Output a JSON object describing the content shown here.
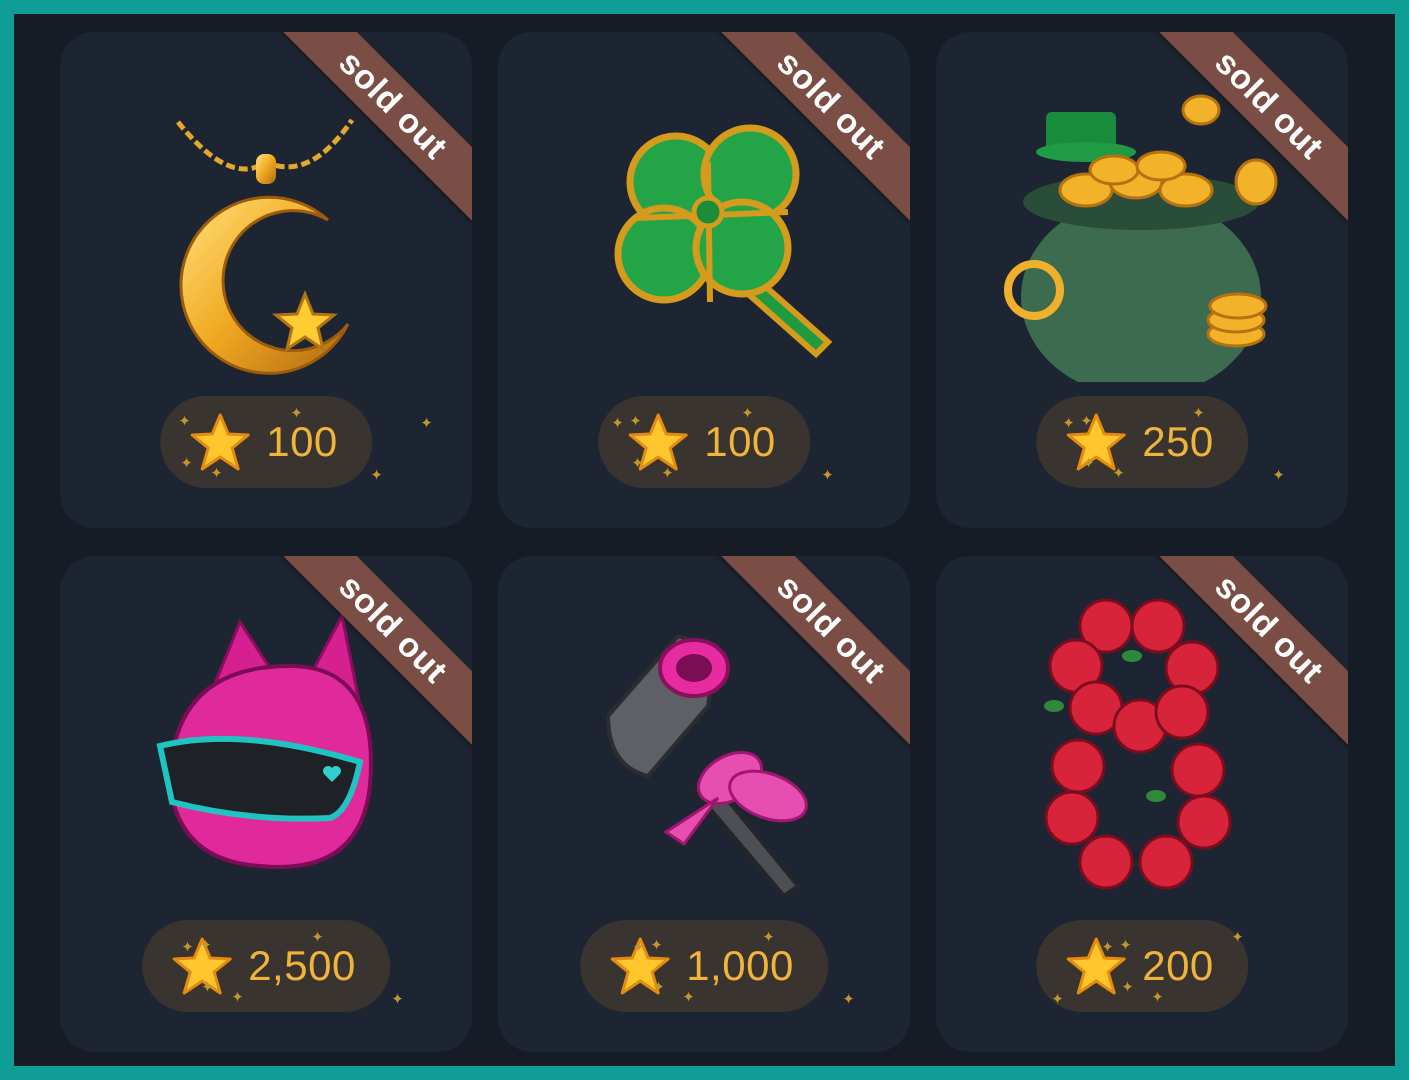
{
  "items": [
    {
      "name": "Crescent moon necklace",
      "badge": "sold out",
      "price": "100",
      "icon": "crescent-necklace-icon"
    },
    {
      "name": "Four-leaf clover",
      "badge": "sold out",
      "price": "100",
      "icon": "clover-icon"
    },
    {
      "name": "Pot of gold",
      "badge": "sold out",
      "price": "250",
      "icon": "pot-of-gold-icon"
    },
    {
      "name": "Cat-ear helmet",
      "badge": "sold out",
      "price": "2,500",
      "icon": "cat-helmet-icon"
    },
    {
      "name": "Hair dryer gift",
      "badge": "sold out",
      "price": "1,000",
      "icon": "hair-dryer-icon"
    },
    {
      "name": "Rose number eight",
      "badge": "sold out",
      "price": "200",
      "icon": "rose-eight-icon"
    }
  ],
  "currency_icon": "star-icon",
  "colors": {
    "frame": "#0f9d96",
    "background": "#151c26",
    "card": "#1e2532",
    "ribbon": "#7a4e45",
    "price_pill": "#39342f",
    "price_text": "#f0b43a"
  }
}
